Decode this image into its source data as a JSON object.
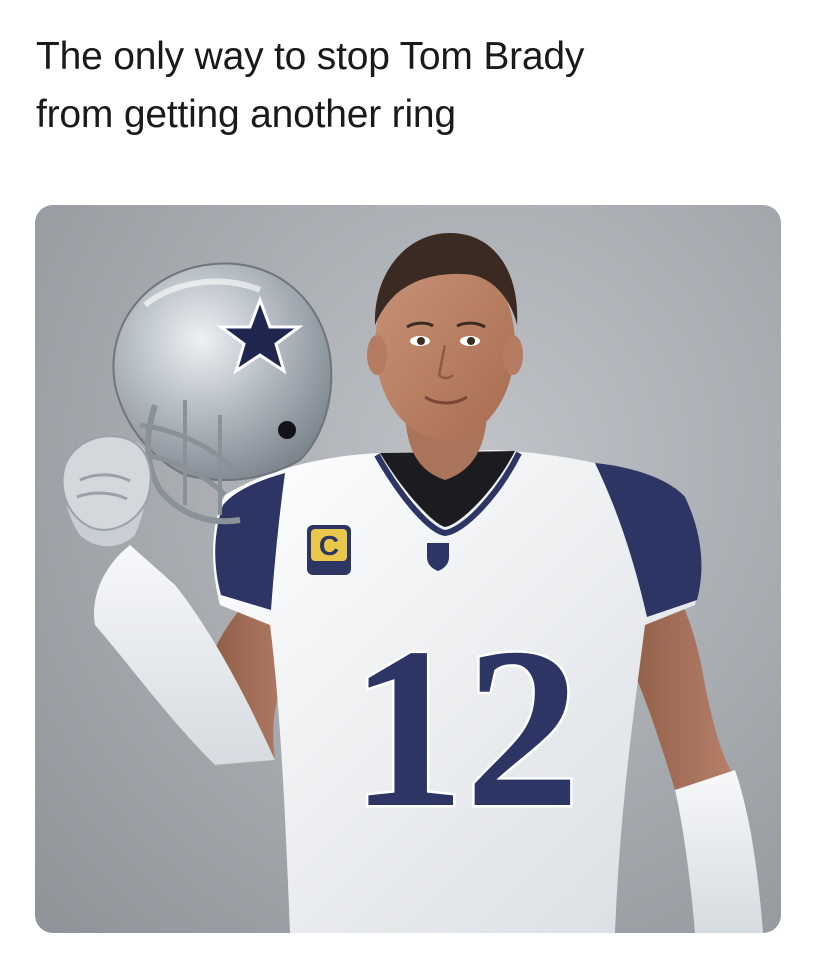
{
  "post": {
    "caption_line1": "The only way to stop Tom Brady",
    "caption_line2": "from getting another ring"
  },
  "photo": {
    "jersey_number": "12",
    "captain_patch": "C",
    "helmet_logo_icon": "star-icon",
    "colors": {
      "jersey": "#f2f4f6",
      "trim_navy": "#2c3564",
      "helmet_silver": "#aeb6bf",
      "background": "#a9adb2"
    }
  }
}
